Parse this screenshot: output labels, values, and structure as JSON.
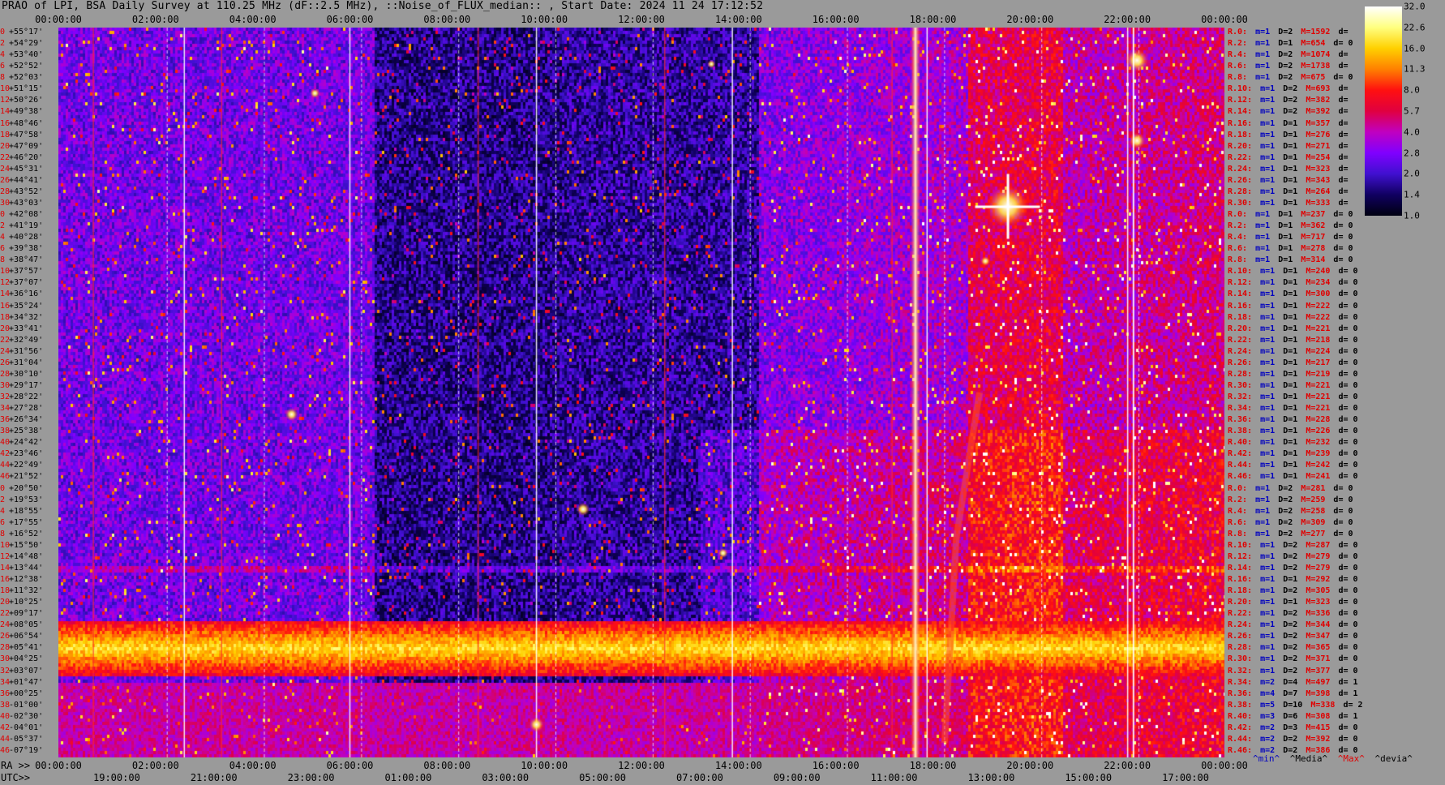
{
  "title": "PRAO of LPI, BSA Daily Survey at 110.25 MHz (dF::2.5 MHz), ::Noise_of_FLUX_median:: , Start Date: 2024 11 24 17:12:52",
  "axes": {
    "ra_prefix": "RA >>",
    "utc_prefix": "UTC>>",
    "top_ticks": [
      "00:00:00",
      "02:00:00",
      "04:00:00",
      "06:00:00",
      "08:00:00",
      "10:00:00",
      "12:00:00",
      "14:00:00",
      "16:00:00",
      "18:00:00",
      "20:00:00",
      "22:00:00",
      "00:00:00"
    ],
    "ra_ticks": [
      "00:00:00",
      "02:00:00",
      "04:00:00",
      "06:00:00",
      "08:00:00",
      "10:00:00",
      "12:00:00",
      "14:00:00",
      "16:00:00",
      "18:00:00",
      "20:00:00",
      "22:00:00",
      "00:00:00"
    ],
    "utc_ticks": [
      "19:00:00",
      "21:00:00",
      "23:00:00",
      "01:00:00",
      "03:00:00",
      "05:00:00",
      "07:00:00",
      "09:00:00",
      "11:00:00",
      "13:00:00",
      "15:00:00",
      "17:00:00"
    ]
  },
  "declinations": [
    {
      "n": "0",
      "dec": "+55°17'"
    },
    {
      "n": "2",
      "dec": "+54°29'"
    },
    {
      "n": "4",
      "dec": "+53°40'"
    },
    {
      "n": "6",
      "dec": "+52°52'"
    },
    {
      "n": "8",
      "dec": "+52°03'"
    },
    {
      "n": "10",
      "dec": "+51°15'"
    },
    {
      "n": "12",
      "dec": "+50°26'"
    },
    {
      "n": "14",
      "dec": "+49°38'"
    },
    {
      "n": "16",
      "dec": "+48°46'"
    },
    {
      "n": "18",
      "dec": "+47°58'"
    },
    {
      "n": "20",
      "dec": "+47°09'"
    },
    {
      "n": "22",
      "dec": "+46°20'"
    },
    {
      "n": "24",
      "dec": "+45°31'"
    },
    {
      "n": "26",
      "dec": "+44°41'"
    },
    {
      "n": "28",
      "dec": "+43°52'"
    },
    {
      "n": "30",
      "dec": "+43°03'"
    },
    {
      "n": "0",
      "dec": "+42°08'"
    },
    {
      "n": "2",
      "dec": "+41°19'"
    },
    {
      "n": "4",
      "dec": "+40°28'"
    },
    {
      "n": "6",
      "dec": "+39°38'"
    },
    {
      "n": "8",
      "dec": "+38°47'"
    },
    {
      "n": "10",
      "dec": "+37°57'"
    },
    {
      "n": "12",
      "dec": "+37°07'"
    },
    {
      "n": "14",
      "dec": "+36°16'"
    },
    {
      "n": "16",
      "dec": "+35°24'"
    },
    {
      "n": "18",
      "dec": "+34°32'"
    },
    {
      "n": "20",
      "dec": "+33°41'"
    },
    {
      "n": "22",
      "dec": "+32°49'"
    },
    {
      "n": "24",
      "dec": "+31°56'"
    },
    {
      "n": "26",
      "dec": "+31°04'"
    },
    {
      "n": "28",
      "dec": "+30°10'"
    },
    {
      "n": "30",
      "dec": "+29°17'"
    },
    {
      "n": "32",
      "dec": "+28°22'"
    },
    {
      "n": "34",
      "dec": "+27°28'"
    },
    {
      "n": "36",
      "dec": "+26°34'"
    },
    {
      "n": "38",
      "dec": "+25°38'"
    },
    {
      "n": "40",
      "dec": "+24°42'"
    },
    {
      "n": "42",
      "dec": "+23°46'"
    },
    {
      "n": "44",
      "dec": "+22°49'"
    },
    {
      "n": "46",
      "dec": "+21°52'"
    },
    {
      "n": "0",
      "dec": "+20°50'"
    },
    {
      "n": "2",
      "dec": "+19°53'"
    },
    {
      "n": "4",
      "dec": "+18°55'"
    },
    {
      "n": "6",
      "dec": "+17°55'"
    },
    {
      "n": "8",
      "dec": "+16°52'"
    },
    {
      "n": "10",
      "dec": "+15°50'"
    },
    {
      "n": "12",
      "dec": "+14°48'"
    },
    {
      "n": "14",
      "dec": "+13°44'"
    },
    {
      "n": "16",
      "dec": "+12°38'"
    },
    {
      "n": "18",
      "dec": "+11°32'"
    },
    {
      "n": "20",
      "dec": "+10°25'"
    },
    {
      "n": "22",
      "dec": "+09°17'"
    },
    {
      "n": "24",
      "dec": "+08°05'"
    },
    {
      "n": "26",
      "dec": "+06°54'"
    },
    {
      "n": "28",
      "dec": "+05°41'"
    },
    {
      "n": "30",
      "dec": "+04°25'"
    },
    {
      "n": "32",
      "dec": "+03°07'"
    },
    {
      "n": "34",
      "dec": "+01°47'"
    },
    {
      "n": "36",
      "dec": "+00°25'"
    },
    {
      "n": "38",
      "dec": "-01°00'"
    },
    {
      "n": "40",
      "dec": "-02°30'"
    },
    {
      "n": "42",
      "dec": "-04°01'"
    },
    {
      "n": "44",
      "dec": "-05°37'"
    },
    {
      "n": "46",
      "dec": "-07°19'"
    }
  ],
  "stats": [
    {
      "r": "R.0:",
      "m": "m=1",
      "d": "D=2",
      "mx": "M=1592",
      "dv": "d="
    },
    {
      "r": "R.2:",
      "m": "m=1",
      "d": "D=1",
      "mx": "M=654",
      "dv": "d= 0"
    },
    {
      "r": "R.4:",
      "m": "m=1",
      "d": "D=2",
      "mx": "M=1074",
      "dv": "d="
    },
    {
      "r": "R.6:",
      "m": "m=1",
      "d": "D=2",
      "mx": "M=1738",
      "dv": "d="
    },
    {
      "r": "R.8:",
      "m": "m=1",
      "d": "D=2",
      "mx": "M=675",
      "dv": "d= 0"
    },
    {
      "r": "R.10:",
      "m": "m=1",
      "d": "D=2",
      "mx": "M=693",
      "dv": "d="
    },
    {
      "r": "R.12:",
      "m": "m=1",
      "d": "D=2",
      "mx": "M=382",
      "dv": "d="
    },
    {
      "r": "R.14:",
      "m": "m=1",
      "d": "D=2",
      "mx": "M=392",
      "dv": "d="
    },
    {
      "r": "R.16:",
      "m": "m=1",
      "d": "D=1",
      "mx": "M=357",
      "dv": "d="
    },
    {
      "r": "R.18:",
      "m": "m=1",
      "d": "D=1",
      "mx": "M=276",
      "dv": "d="
    },
    {
      "r": "R.20:",
      "m": "m=1",
      "d": "D=1",
      "mx": "M=271",
      "dv": "d="
    },
    {
      "r": "R.22:",
      "m": "m=1",
      "d": "D=1",
      "mx": "M=254",
      "dv": "d="
    },
    {
      "r": "R.24:",
      "m": "m=1",
      "d": "D=1",
      "mx": "M=323",
      "dv": "d="
    },
    {
      "r": "R.26:",
      "m": "m=1",
      "d": "D=1",
      "mx": "M=343",
      "dv": "d="
    },
    {
      "r": "R.28:",
      "m": "m=1",
      "d": "D=1",
      "mx": "M=264",
      "dv": "d="
    },
    {
      "r": "R.30:",
      "m": "m=1",
      "d": "D=1",
      "mx": "M=333",
      "dv": "d="
    },
    {
      "r": "R.0:",
      "m": "m=1",
      "d": "D=1",
      "mx": "M=237",
      "dv": "d= 0"
    },
    {
      "r": "R.2:",
      "m": "m=1",
      "d": "D=1",
      "mx": "M=362",
      "dv": "d= 0"
    },
    {
      "r": "R.4:",
      "m": "m=1",
      "d": "D=1",
      "mx": "M=717",
      "dv": "d= 0"
    },
    {
      "r": "R.6:",
      "m": "m=1",
      "d": "D=1",
      "mx": "M=278",
      "dv": "d= 0"
    },
    {
      "r": "R.8:",
      "m": "m=1",
      "d": "D=1",
      "mx": "M=314",
      "dv": "d= 0"
    },
    {
      "r": "R.10:",
      "m": "m=1",
      "d": "D=1",
      "mx": "M=240",
      "dv": "d= 0"
    },
    {
      "r": "R.12:",
      "m": "m=1",
      "d": "D=1",
      "mx": "M=234",
      "dv": "d= 0"
    },
    {
      "r": "R.14:",
      "m": "m=1",
      "d": "D=1",
      "mx": "M=300",
      "dv": "d= 0"
    },
    {
      "r": "R.16:",
      "m": "m=1",
      "d": "D=1",
      "mx": "M=222",
      "dv": "d= 0"
    },
    {
      "r": "R.18:",
      "m": "m=1",
      "d": "D=1",
      "mx": "M=222",
      "dv": "d= 0"
    },
    {
      "r": "R.20:",
      "m": "m=1",
      "d": "D=1",
      "mx": "M=221",
      "dv": "d= 0"
    },
    {
      "r": "R.22:",
      "m": "m=1",
      "d": "D=1",
      "mx": "M=218",
      "dv": "d= 0"
    },
    {
      "r": "R.24:",
      "m": "m=1",
      "d": "D=1",
      "mx": "M=224",
      "dv": "d= 0"
    },
    {
      "r": "R.26:",
      "m": "m=1",
      "d": "D=1",
      "mx": "M=217",
      "dv": "d= 0"
    },
    {
      "r": "R.28:",
      "m": "m=1",
      "d": "D=1",
      "mx": "M=219",
      "dv": "d= 0"
    },
    {
      "r": "R.30:",
      "m": "m=1",
      "d": "D=1",
      "mx": "M=221",
      "dv": "d= 0"
    },
    {
      "r": "R.32:",
      "m": "m=1",
      "d": "D=1",
      "mx": "M=221",
      "dv": "d= 0"
    },
    {
      "r": "R.34:",
      "m": "m=1",
      "d": "D=1",
      "mx": "M=221",
      "dv": "d= 0"
    },
    {
      "r": "R.36:",
      "m": "m=1",
      "d": "D=1",
      "mx": "M=228",
      "dv": "d= 0"
    },
    {
      "r": "R.38:",
      "m": "m=1",
      "d": "D=1",
      "mx": "M=226",
      "dv": "d= 0"
    },
    {
      "r": "R.40:",
      "m": "m=1",
      "d": "D=1",
      "mx": "M=232",
      "dv": "d= 0"
    },
    {
      "r": "R.42:",
      "m": "m=1",
      "d": "D=1",
      "mx": "M=239",
      "dv": "d= 0"
    },
    {
      "r": "R.44:",
      "m": "m=1",
      "d": "D=1",
      "mx": "M=242",
      "dv": "d= 0"
    },
    {
      "r": "R.46:",
      "m": "m=1",
      "d": "D=1",
      "mx": "M=241",
      "dv": "d= 0"
    },
    {
      "r": "R.0:",
      "m": "m=1",
      "d": "D=2",
      "mx": "M=281",
      "dv": "d= 0"
    },
    {
      "r": "R.2:",
      "m": "m=1",
      "d": "D=2",
      "mx": "M=259",
      "dv": "d= 0"
    },
    {
      "r": "R.4:",
      "m": "m=1",
      "d": "D=2",
      "mx": "M=258",
      "dv": "d= 0"
    },
    {
      "r": "R.6:",
      "m": "m=1",
      "d": "D=2",
      "mx": "M=309",
      "dv": "d= 0"
    },
    {
      "r": "R.8:",
      "m": "m=1",
      "d": "D=2",
      "mx": "M=277",
      "dv": "d= 0"
    },
    {
      "r": "R.10:",
      "m": "m=1",
      "d": "D=2",
      "mx": "M=287",
      "dv": "d= 0"
    },
    {
      "r": "R.12:",
      "m": "m=1",
      "d": "D=2",
      "mx": "M=279",
      "dv": "d= 0"
    },
    {
      "r": "R.14:",
      "m": "m=1",
      "d": "D=2",
      "mx": "M=279",
      "dv": "d= 0"
    },
    {
      "r": "R.16:",
      "m": "m=1",
      "d": "D=1",
      "mx": "M=292",
      "dv": "d= 0"
    },
    {
      "r": "R.18:",
      "m": "m=1",
      "d": "D=2",
      "mx": "M=305",
      "dv": "d= 0"
    },
    {
      "r": "R.20:",
      "m": "m=1",
      "d": "D=1",
      "mx": "M=323",
      "dv": "d= 0"
    },
    {
      "r": "R.22:",
      "m": "m=1",
      "d": "D=2",
      "mx": "M=336",
      "dv": "d= 0"
    },
    {
      "r": "R.24:",
      "m": "m=1",
      "d": "D=2",
      "mx": "M=344",
      "dv": "d= 0"
    },
    {
      "r": "R.26:",
      "m": "m=1",
      "d": "D=2",
      "mx": "M=347",
      "dv": "d= 0"
    },
    {
      "r": "R.28:",
      "m": "m=1",
      "d": "D=2",
      "mx": "M=365",
      "dv": "d= 0"
    },
    {
      "r": "R.30:",
      "m": "m=1",
      "d": "D=2",
      "mx": "M=371",
      "dv": "d= 0"
    },
    {
      "r": "R.32:",
      "m": "m=1",
      "d": "D=2",
      "mx": "M=377",
      "dv": "d= 0"
    },
    {
      "r": "R.34:",
      "m": "m=2",
      "d": "D=4",
      "mx": "M=497",
      "dv": "d= 1"
    },
    {
      "r": "R.36:",
      "m": "m=4",
      "d": "D=7",
      "mx": "M=398",
      "dv": "d= 1"
    },
    {
      "r": "R.38:",
      "m": "m=5",
      "d": "D=10",
      "mx": "M=338",
      "dv": "d= 2"
    },
    {
      "r": "R.40:",
      "m": "m=3",
      "d": "D=6",
      "mx": "M=308",
      "dv": "d= 1"
    },
    {
      "r": "R.42:",
      "m": "m=2",
      "d": "D=3",
      "mx": "M=415",
      "dv": "d= 0"
    },
    {
      "r": "R.44:",
      "m": "m=2",
      "d": "D=2",
      "mx": "M=392",
      "dv": "d= 0"
    },
    {
      "r": "R.46:",
      "m": "m=2",
      "d": "D=2",
      "mx": "M=386",
      "dv": "d= 0"
    }
  ],
  "stat_legend": {
    "min": "^min^",
    "median": "^Media^",
    "max": "^Max^",
    "dev": "^devia^"
  },
  "colorbar": {
    "ticks": [
      "32.0",
      "22.6",
      "16.0",
      "11.3",
      "8.0",
      "5.7",
      "4.0",
      "2.8",
      "2.0",
      "1.4",
      "1.0"
    ],
    "colors": [
      "#ffffff",
      "#ffff80",
      "#ffd000",
      "#ff8000",
      "#ff1010",
      "#e00040",
      "#c000c0",
      "#8000ff",
      "#4010d0",
      "#100060",
      "#000010"
    ]
  },
  "chart_data": {
    "type": "heatmap",
    "title": "PRAO of LPI, BSA Daily Survey at 110.25 MHz (dF::2.5 MHz), ::Noise_of_FLUX_median:: , Start Date: 2024 11 24 17:12:52",
    "x_axis": "RA 00:00:00 to 24:00:00 (UTC 17:12:52 start)",
    "y_axis": "Declination beams +55°17' to -07°19'",
    "value_range": [
      1.0,
      32.0
    ],
    "scale": "log2",
    "features": [
      {
        "name": "bright horizontal band",
        "dec_range": [
          "+01°47'",
          "-02°30'"
        ],
        "level": 8.0
      },
      {
        "name": "bright vertical interference",
        "ra": "18:40",
        "level": 32.0
      },
      {
        "name": "bright source",
        "ra": "19:55",
        "dec": "+41°19'",
        "level": 32.0
      },
      {
        "name": "strong source",
        "ra": "22:50",
        "dec": "+52°52'",
        "level": 32.0
      }
    ]
  }
}
